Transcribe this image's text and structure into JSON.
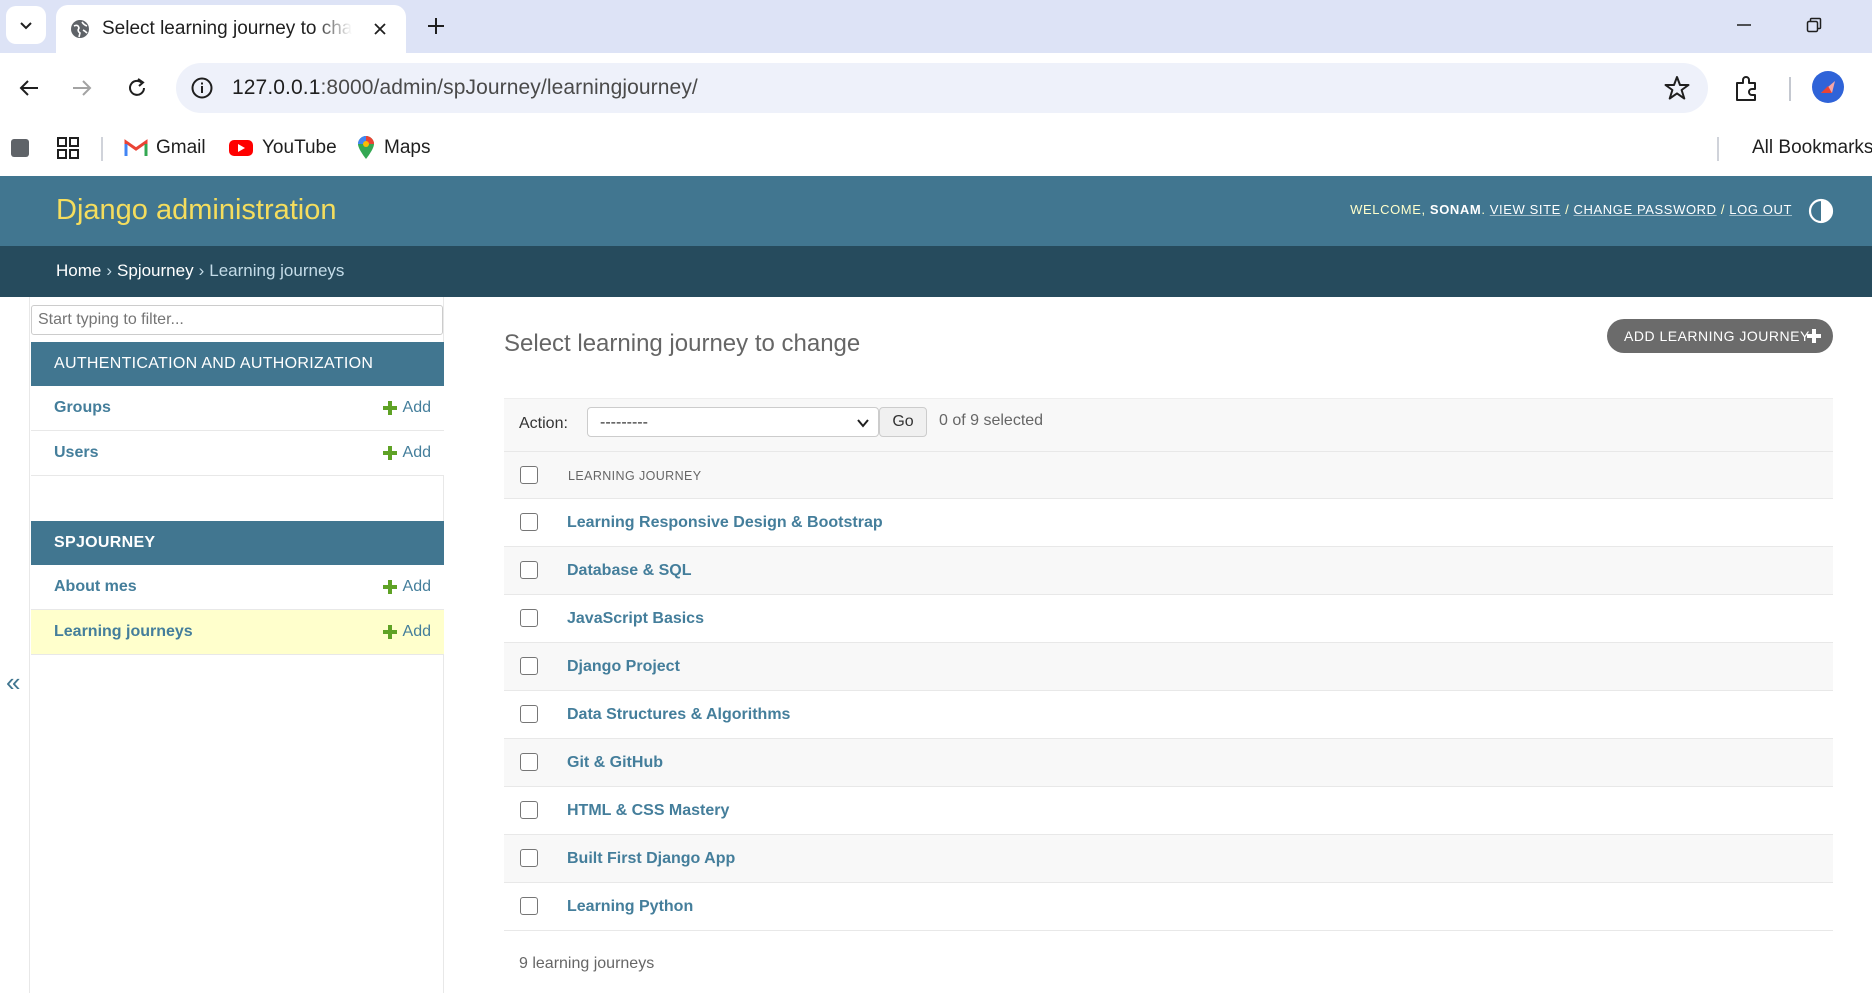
{
  "browser": {
    "tab_title": "Select learning journey to change",
    "new_tab_label": "+",
    "url_host": "127.0.0.1",
    "url_rest": ":8000/admin/spJourney/learningjourney/",
    "bookmarks": [
      {
        "label": "Gmail",
        "icon": "gmail-icon"
      },
      {
        "label": "YouTube",
        "icon": "youtube-icon"
      },
      {
        "label": "Maps",
        "icon": "maps-icon"
      }
    ],
    "all_bookmarks": "All Bookmarks"
  },
  "admin": {
    "brand": "Django administration",
    "welcome": "Welcome,",
    "username": "sonam",
    "view_site": "View site",
    "change_password": "Change password",
    "log_out": "Log out",
    "breadcrumbs": [
      "Home",
      "Spjourney",
      "Learning journeys"
    ],
    "sidebar": {
      "filter_placeholder": "Start typing to filter...",
      "apps": [
        {
          "caption": "Authentication and Authorization",
          "models": [
            {
              "name": "Groups",
              "add": "Add"
            },
            {
              "name": "Users",
              "add": "Add"
            }
          ]
        },
        {
          "caption": "Spjourney",
          "models": [
            {
              "name": "About mes",
              "add": "Add"
            },
            {
              "name": "Learning journeys",
              "add": "Add"
            }
          ]
        }
      ],
      "collapse_glyph": "«"
    },
    "content": {
      "title": "Select learning journey to change",
      "add_button": "Add learning journey",
      "action_label": "Action:",
      "action_selected": "---------",
      "go_label": "Go",
      "selected_count": "0 of 9 selected",
      "column_header": "Learning journey",
      "rows": [
        "Learning Responsive Design & Bootstrap",
        "Database & SQL",
        "JavaScript Basics",
        "Django Project",
        "Data Structures & Algorithms",
        "Git & GitHub",
        "HTML & CSS Mastery",
        "Built First Django App",
        "Learning Python"
      ],
      "paginator": "9 learning journeys"
    }
  },
  "colors": {
    "header": "#417690",
    "breadcrumbs": "#264b5d",
    "brand": "#f5dd5d",
    "link": "#447e9b",
    "add_green": "#5fa225",
    "current_row": "#ffffcc"
  }
}
